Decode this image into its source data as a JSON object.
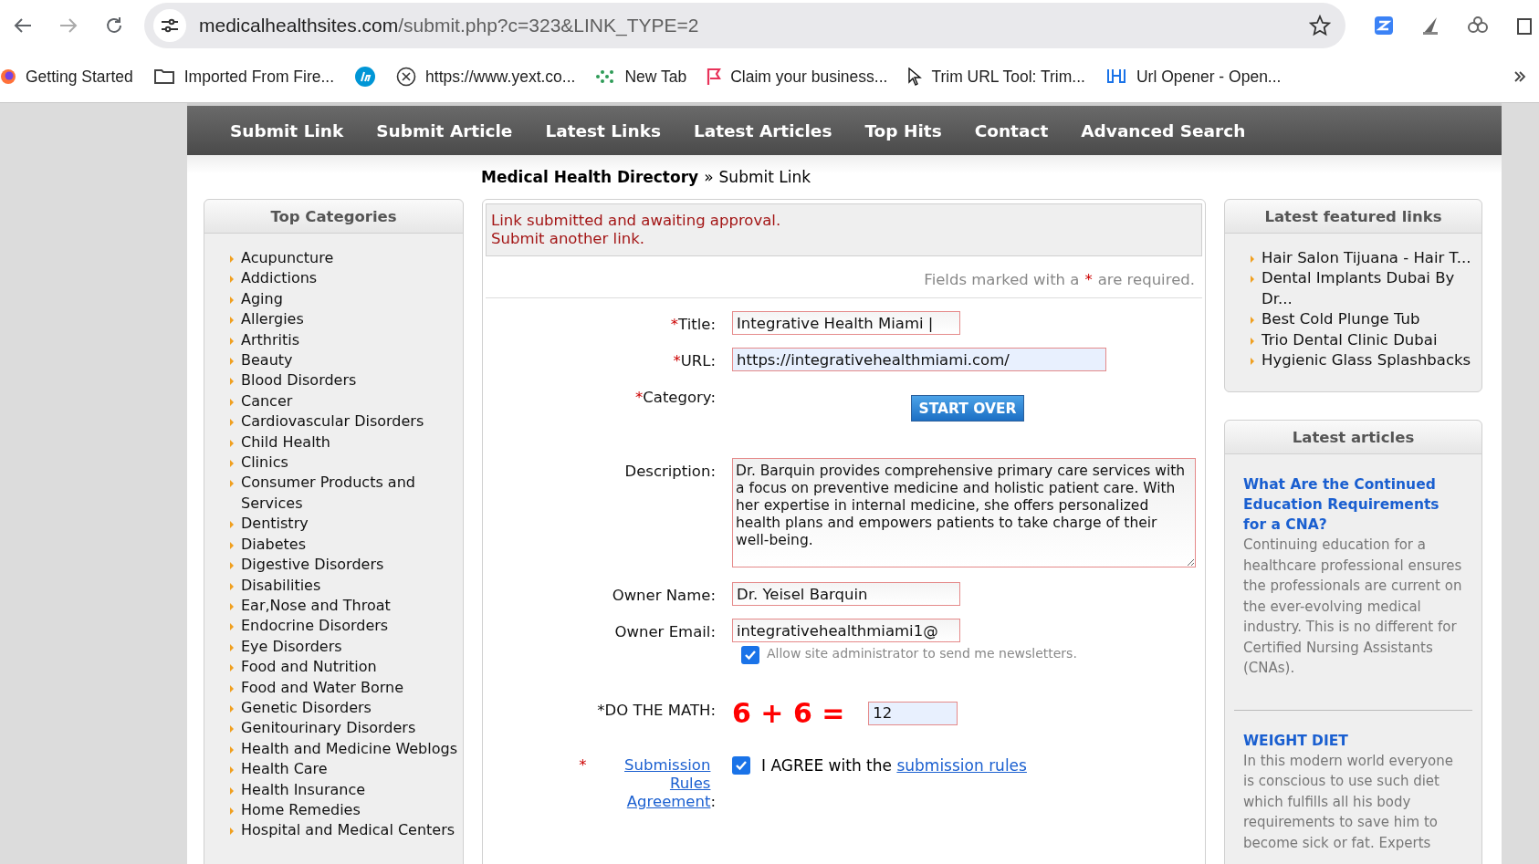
{
  "browser": {
    "url_host": "medicalhealthsites.com",
    "url_path": "/submit.php?c=323&LINK_TYPE=2",
    "bookmarks": [
      {
        "label": "Getting Started",
        "kind": "firefox"
      },
      {
        "label": "Imported From Fire...",
        "kind": "folder"
      },
      {
        "kind": "hp"
      },
      {
        "label": "https://www.yext.co...",
        "kind": "globe"
      },
      {
        "label": "New Tab",
        "kind": "dots"
      },
      {
        "label": "Claim your business...",
        "kind": "flag"
      },
      {
        "label": "Trim URL Tool: Trim...",
        "kind": "cursor"
      },
      {
        "label": "Url Opener - Open...",
        "kind": "link"
      }
    ]
  },
  "nav": [
    "Submit Link",
    "Submit Article",
    "Latest Links",
    "Latest Articles",
    "Top Hits",
    "Contact",
    "Advanced Search"
  ],
  "breadcrumb": {
    "home": "Medical Health Directory",
    "separator": "»",
    "current": "Submit Link"
  },
  "top_categories": {
    "title": "Top Categories",
    "items": [
      "Acupuncture",
      "Addictions",
      "Aging",
      "Allergies",
      "Arthritis",
      "Beauty",
      "Blood Disorders",
      "Cancer",
      "Cardiovascular Disorders",
      "Child Health",
      "Clinics",
      "Consumer Products and Services",
      "Dentistry",
      "Diabetes",
      "Digestive Disorders",
      "Disabilities",
      "Ear,Nose and Throat",
      "Endocrine Disorders",
      "Eye Disorders",
      "Food and Nutrition",
      "Food and Water Borne",
      "Genetic Disorders",
      "Genitourinary Disorders",
      "Health and Medicine Weblogs",
      "Health Care",
      "Health Insurance",
      "Home Remedies",
      "Hospital and Medical Centers"
    ]
  },
  "form": {
    "messages": [
      "Link submitted and awaiting approval.",
      "Submit another link."
    ],
    "required_note": {
      "before": "Fields marked with a",
      "mark": "*",
      "after": "are required."
    },
    "title": {
      "label": "Title:",
      "required": true,
      "value": "Integrative Health Miami |"
    },
    "url": {
      "label": "URL:",
      "required": true,
      "value": "https://integrativehealthmiami.com/"
    },
    "category": {
      "label": "Category:",
      "required": true,
      "button": "START OVER"
    },
    "description": {
      "label": "Description:",
      "required": false,
      "value": "Dr. Barquin provides comprehensive primary care services with a focus on preventive medicine and holistic patient care. With her expertise in internal medicine, she offers personalized health plans and empowers patients to take charge of their well-being."
    },
    "owner_name": {
      "label": "Owner Name:",
      "required": false,
      "value": "Dr. Yeisel Barquin"
    },
    "owner_email": {
      "label": "Owner Email:",
      "required": false,
      "value": "integrativehealthmiami1@"
    },
    "newsletter": {
      "label": "Allow site administrator to send me newsletters.",
      "checked": true
    },
    "math": {
      "label": "*DO THE MATH:",
      "question": "6 + 6 =",
      "answer": "12"
    },
    "agreement": {
      "label_link": "Submission Rules Agreement",
      "label_suffix": ":",
      "required": true,
      "checked": true,
      "text": "I AGREE with the",
      "link": "submission rules"
    }
  },
  "featured_links": {
    "title": "Latest featured links",
    "items": [
      "Hair Salon Tijuana - Hair T...",
      "Dental Implants Dubai By Dr...",
      "Best Cold Plunge Tub",
      "Trio Dental Clinic Dubai",
      "Hygienic Glass Splashbacks"
    ]
  },
  "latest_articles": {
    "title": "Latest articles",
    "items": [
      {
        "title": "What Are the Continued Education Requirements for a CNA?",
        "summary": "Continuing education for a healthcare professional ensures the professionals are current on the ever-evolving medical industry. This is no different for Certified Nursing Assistants (CNAs)."
      },
      {
        "title": "WEIGHT DIET",
        "summary": "In this modern world everyone is conscious to use such diet which fulfills all his body requirements to save him to become sick or fat. Experts"
      }
    ]
  }
}
